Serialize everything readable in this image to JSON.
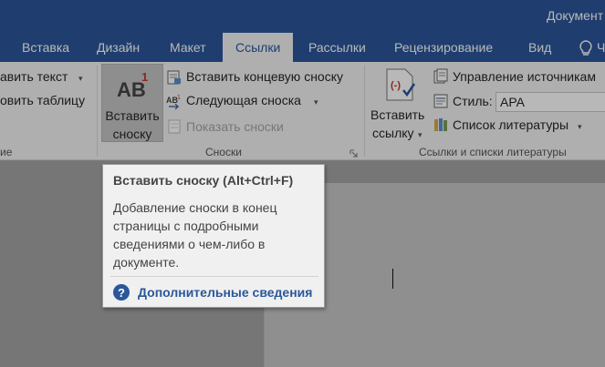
{
  "window": {
    "title": "Документ"
  },
  "tabs": [
    {
      "label": "Вставка"
    },
    {
      "label": "Дизайн"
    },
    {
      "label": "Макет"
    },
    {
      "label": "Ссылки"
    },
    {
      "label": "Рассылки"
    },
    {
      "label": "Рецензирование"
    },
    {
      "label": "Вид"
    },
    {
      "label": "Ч"
    }
  ],
  "ribbon": {
    "toc_group": {
      "item1": "авить текст",
      "item2": "овить таблицу",
      "label": "ие"
    },
    "footnotes_group": {
      "insert_footnote_line1": "Вставить",
      "insert_footnote_line2": "сноску",
      "insert_endnote": "Вставить концевую сноску",
      "next_footnote": "Следующая сноска",
      "show_notes": "Показать сноски",
      "label": "Сноски"
    },
    "citations_group": {
      "insert_citation_line1": "Вставить",
      "insert_citation_line2": "ссылку",
      "manage_sources": "Управление источникам",
      "style_label": "Стиль:",
      "style_value": "APA",
      "bibliography": "Список литературы",
      "label": "Ссылки и списки литературы"
    }
  },
  "tooltip": {
    "title": "Вставить сноску (Alt+Ctrl+F)",
    "body": "Добавление сноски в конец страницы с подробными сведениями о чем-либо в документе.",
    "more_info": "Дополнительные сведения"
  },
  "colors": {
    "accent": "#2b579a",
    "ribbon_bg": "#f3f3f3",
    "tooltip_bg": "#f0f0f0"
  }
}
